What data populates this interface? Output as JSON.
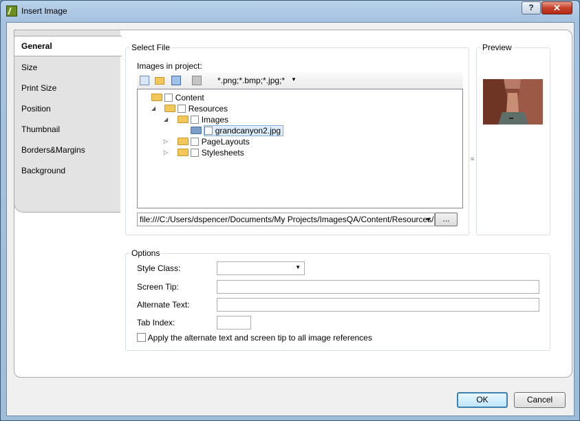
{
  "window": {
    "title": "Insert Image",
    "help_label": "?",
    "close_label": "✕"
  },
  "sidebar": {
    "items": [
      {
        "label": "General",
        "active": true
      },
      {
        "label": "Size"
      },
      {
        "label": "Print Size"
      },
      {
        "label": "Position"
      },
      {
        "label": "Thumbnail"
      },
      {
        "label": "Borders&Margins"
      },
      {
        "label": "Background"
      }
    ]
  },
  "select_file": {
    "group_label": "Select File",
    "images_label": "Images in project:",
    "filter": "*.png;*.bmp;*.jpg;*",
    "tree": [
      {
        "label": "Content",
        "expander": ""
      },
      {
        "label": "Resources",
        "expander": "◢"
      },
      {
        "label": "Images",
        "expander": "◢"
      },
      {
        "label": "grandcanyon2.jpg",
        "expander": ""
      },
      {
        "label": "PageLayouts",
        "expander": "▷"
      },
      {
        "label": "Stylesheets",
        "expander": "▷"
      }
    ],
    "path": "file:///C:/Users/dspencer/Documents/My Projects/ImagesQA/Content/Resources/Im",
    "browse_label": "..."
  },
  "preview": {
    "group_label": "Preview"
  },
  "options": {
    "group_label": "Options",
    "style_class_label": "Style Class:",
    "style_class_value": "",
    "screen_tip_label": "Screen Tip:",
    "screen_tip_value": "",
    "alt_text_label": "Alternate Text:",
    "alt_text_value": "",
    "tab_index_label": "Tab Index:",
    "tab_index_value": "",
    "apply_label": "Apply the alternate text and screen tip to all image references"
  },
  "buttons": {
    "ok": "OK",
    "cancel": "Cancel"
  },
  "splitter_glyph": "≡"
}
